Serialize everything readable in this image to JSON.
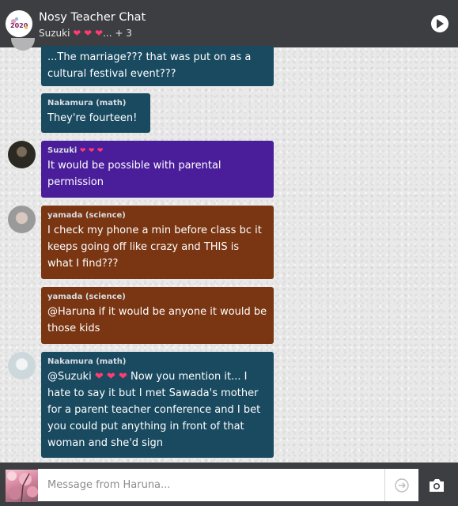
{
  "header": {
    "title": "Nosy Teacher Chat",
    "subtitle_prefix": "Suzuki",
    "subtitle_suffix": "... + 3",
    "logo_text": "2020"
  },
  "messages": [
    {
      "name": "",
      "text": "...The marriage??? that was put on as a cultural festival event???",
      "color": "#194a60"
    },
    {
      "name": "Nakamura (math)",
      "text": "They're fourteen!",
      "color": "#194a60"
    },
    {
      "name": "Suzuki",
      "text": "It would be possible with parental permission",
      "color": "#4a1e9a"
    },
    {
      "name": "yamada (science)",
      "text": "I check my phone a min before class bc it keeps going off like crazy and THIS is what I find???",
      "color": "#7a3512"
    },
    {
      "name": "yamada (science)",
      "text": "@Haruna if it would be anyone it would be those kids",
      "color": "#7a3512"
    },
    {
      "name": "Nakamura (math)",
      "text_prefix": "@Suzuki",
      "text_rest": "Now you mention it... I hate to say it but I met Sawada's mother for a parent teacher conference and I bet you could put anything in front of that woman and she'd sign",
      "color": "#194a60"
    }
  ],
  "composer": {
    "placeholder": "Message from Haruna..."
  },
  "icons": {
    "play": "play-icon",
    "send": "send-icon",
    "camera": "camera-icon",
    "heart": "heart-icon"
  }
}
